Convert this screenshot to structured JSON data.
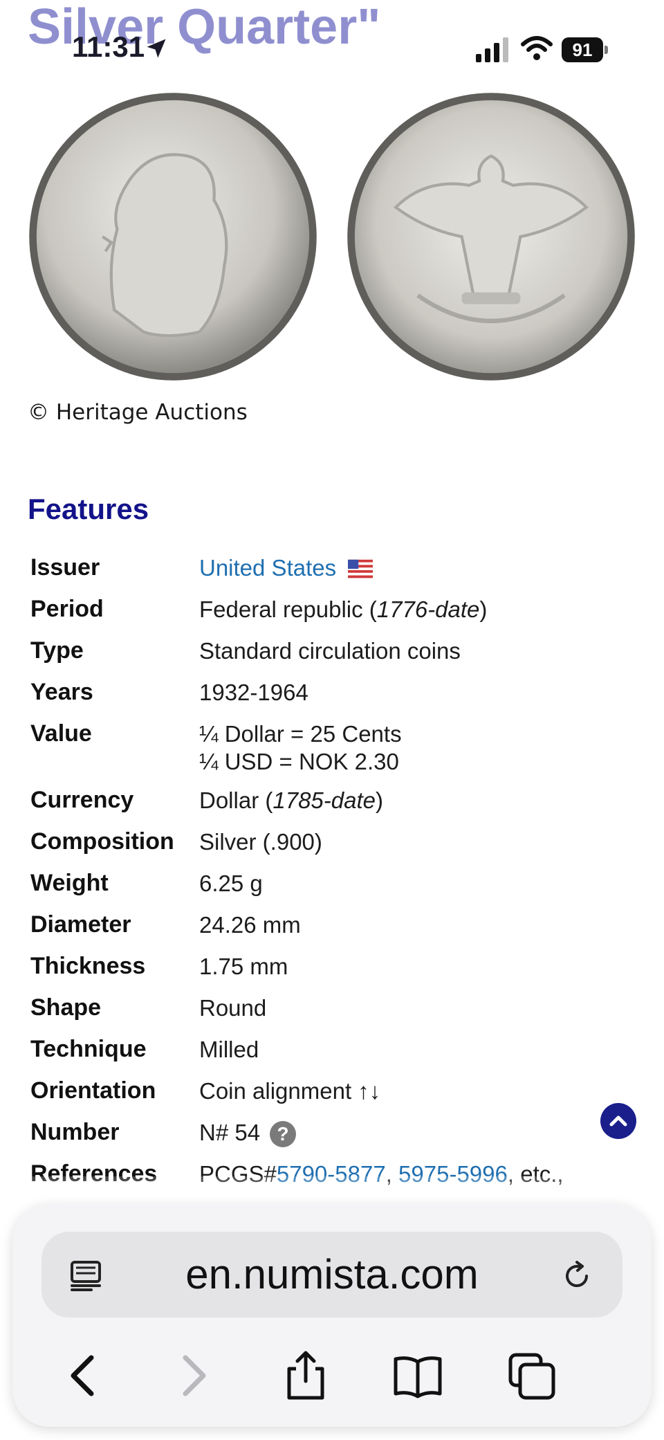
{
  "page": {
    "title_fragment": "Silver Quarter\""
  },
  "status_bar": {
    "time": "11:31",
    "battery": "91",
    "icons": [
      "location-arrow-icon",
      "signal-icon",
      "wifi-icon",
      "battery-icon"
    ]
  },
  "credit": "© Heritage Auctions",
  "features": {
    "heading": "Features",
    "rows": {
      "issuer": {
        "label": "Issuer",
        "value": "United States"
      },
      "period": {
        "label": "Period",
        "value_main": "Federal republic (",
        "value_italic": "1776-date",
        "value_end": ")"
      },
      "type": {
        "label": "Type",
        "value": "Standard circulation coins"
      },
      "years": {
        "label": "Years",
        "value": "1932-1964"
      },
      "value": {
        "label": "Value",
        "line1": "¼ Dollar = 25 Cents",
        "line2": "¼ USD = NOK 2.30"
      },
      "currency": {
        "label": "Currency",
        "value_main": "Dollar (",
        "value_italic": "1785-date",
        "value_end": ")"
      },
      "composition": {
        "label": "Composition",
        "value": "Silver (.900)"
      },
      "weight": {
        "label": "Weight",
        "value": "6.25 g"
      },
      "diameter": {
        "label": "Diameter",
        "value": "24.26 mm"
      },
      "thickness": {
        "label": "Thickness",
        "value": "1.75 mm"
      },
      "shape": {
        "label": "Shape",
        "value": "Round"
      },
      "technique": {
        "label": "Technique",
        "value": "Milled"
      },
      "orientation": {
        "label": "Orientation",
        "value": "Coin alignment ↑↓"
      },
      "number": {
        "label": "Number",
        "value": "N# 54",
        "help": "?"
      },
      "references": {
        "label": "References",
        "prefix": "PCGS#",
        "link1": "5790-5877",
        "sep": ", ",
        "link2": "5975-5996",
        "suffix": ", etc.,"
      }
    }
  },
  "browser": {
    "url": "en.numista.com",
    "icons": [
      "reader-icon",
      "reload-icon",
      "back-icon",
      "forward-icon",
      "share-icon",
      "bookmarks-icon",
      "tabs-icon"
    ]
  },
  "colors": {
    "heading": "#13138a",
    "link": "#1f6fb0",
    "title_faded": "#8f8fd0",
    "scroll_button": "#1a1f8c"
  }
}
